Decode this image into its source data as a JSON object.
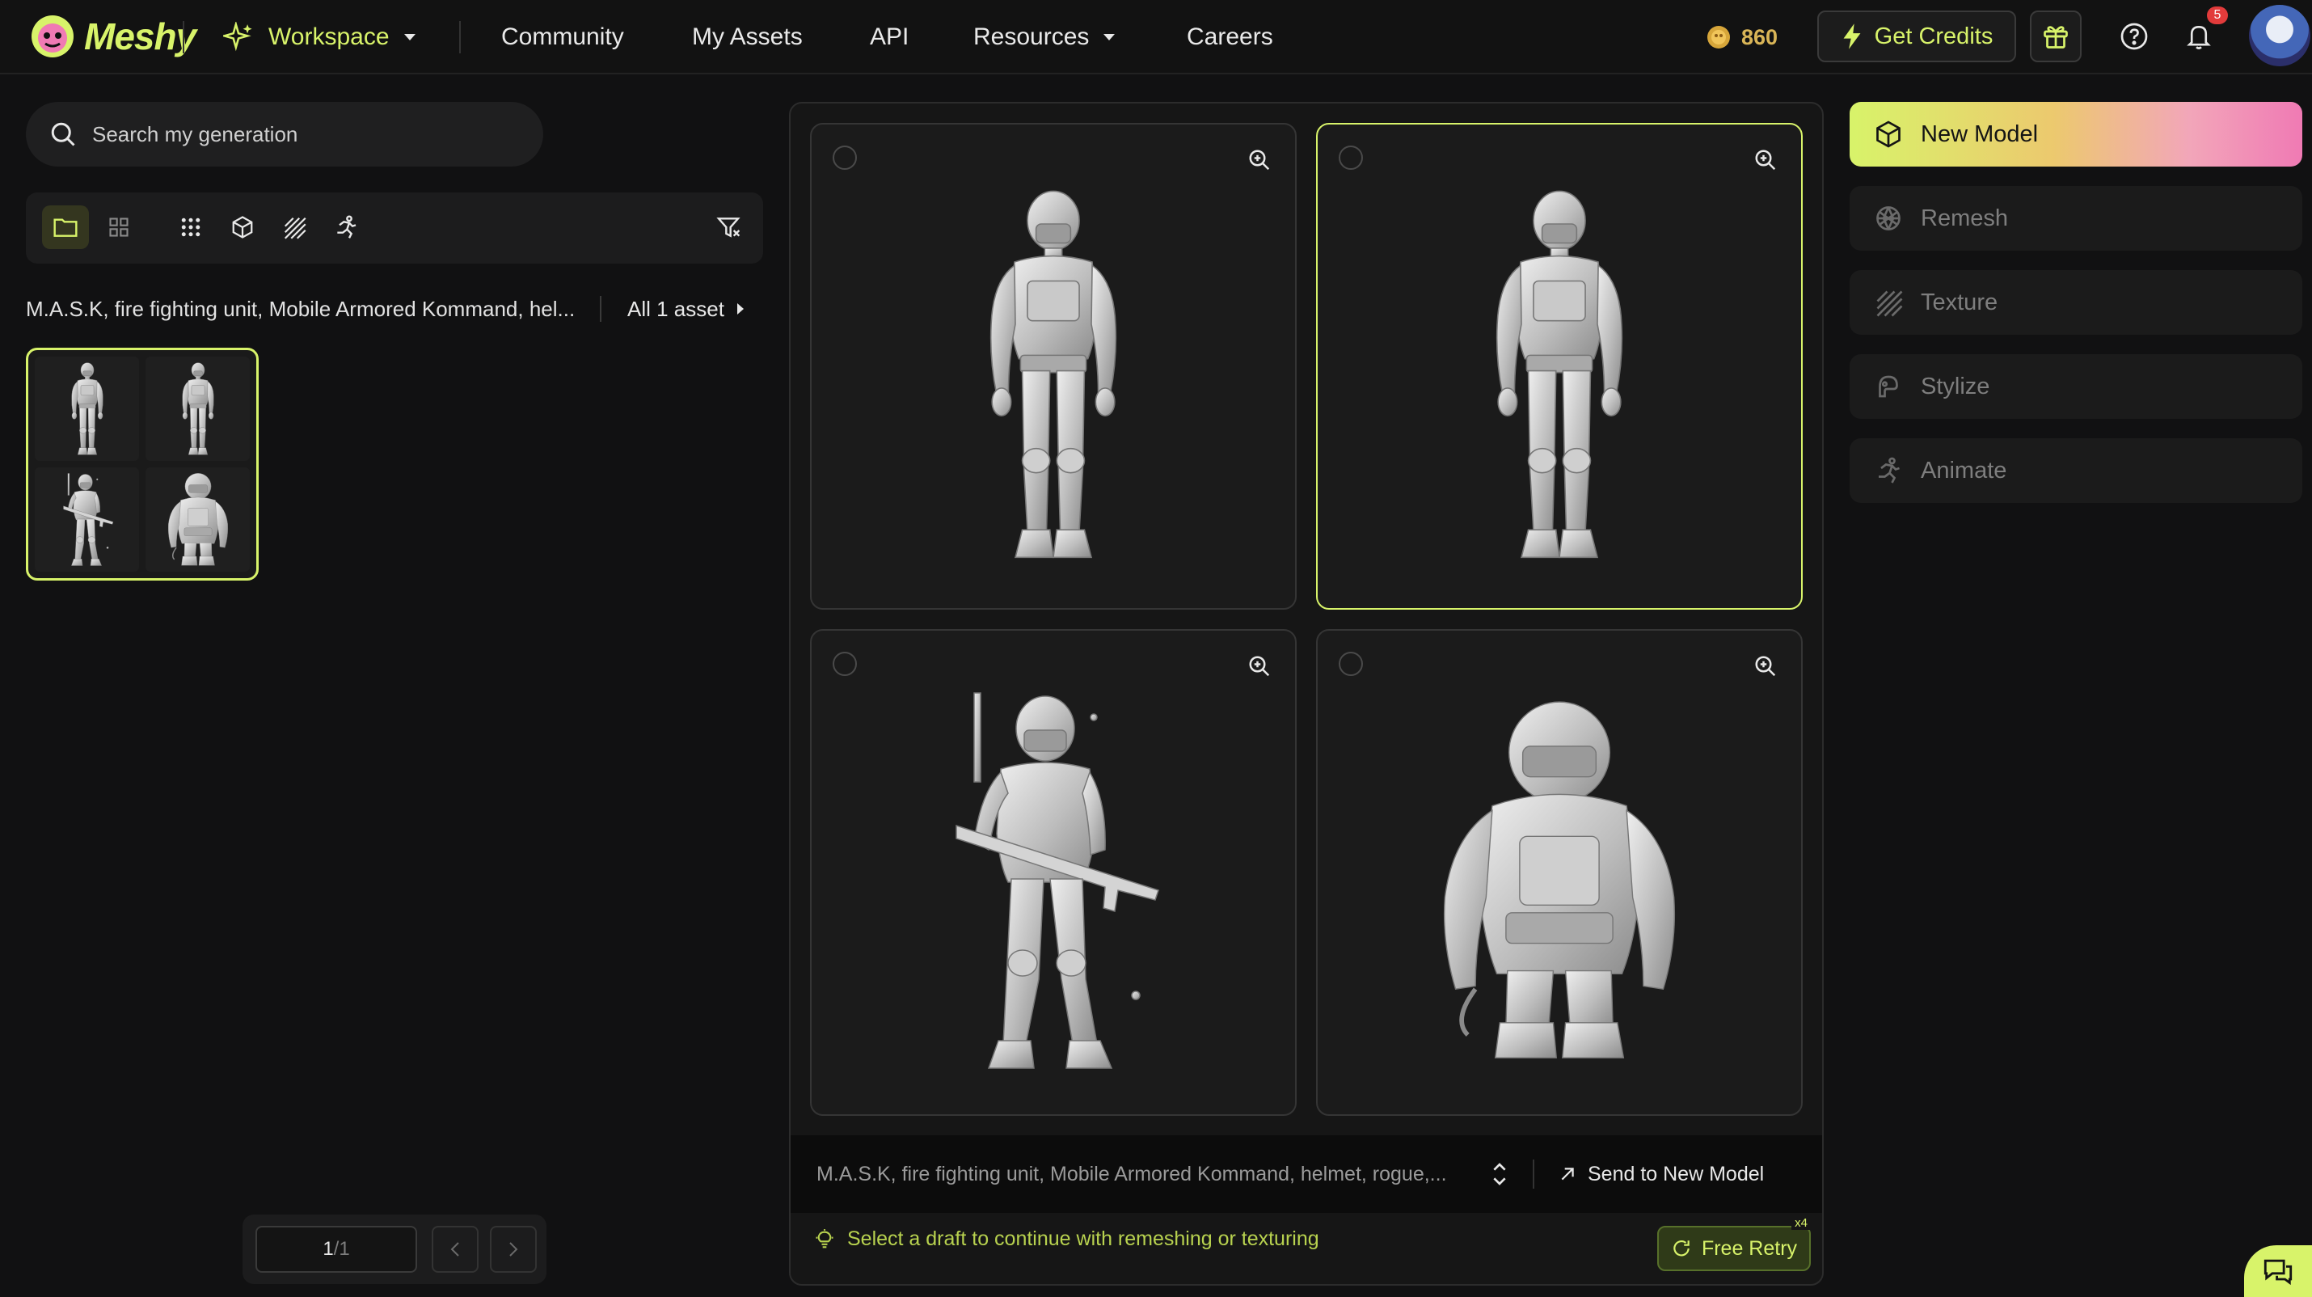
{
  "app": {
    "brand": "Meshy",
    "accent": "#d8f36a"
  },
  "nav": {
    "items": [
      {
        "label": "Workspace",
        "icon": "sparkle-icon",
        "dropdown": true
      },
      {
        "label": "Community"
      },
      {
        "label": "My Assets"
      },
      {
        "label": "API"
      },
      {
        "label": "Resources",
        "dropdown": true
      },
      {
        "label": "Careers"
      }
    ],
    "credits": "860",
    "get_credits_label": "Get Credits",
    "notification_count": "5"
  },
  "sidebar": {
    "search_placeholder": "Search my generation",
    "filters": [
      "folder-view",
      "grid-view",
      "all-types",
      "model",
      "texture",
      "animation"
    ],
    "prompt": "M.A.S.K, fire fighting unit, Mobile Armored Kommand, hel...",
    "all_assets_label": "All 1 asset",
    "pager": {
      "current": "1",
      "total": "/1"
    }
  },
  "center": {
    "drafts": [
      {
        "id": "draft-1",
        "selected": false
      },
      {
        "id": "draft-2",
        "selected": true
      },
      {
        "id": "draft-3",
        "selected": false
      },
      {
        "id": "draft-4",
        "selected": false
      }
    ],
    "prompt": "M.A.S.K, fire fighting unit, Mobile Armored Kommand, helmet, rogue,...",
    "send_label": "Send to New Model",
    "hint": "Select a draft to continue with remeshing or texturing",
    "retry_label": "Free Retry",
    "retry_count": "x4"
  },
  "tools": [
    {
      "label": "New Model",
      "icon": "cube-icon",
      "primary": true
    },
    {
      "label": "Remesh",
      "icon": "remesh-icon"
    },
    {
      "label": "Texture",
      "icon": "texture-icon"
    },
    {
      "label": "Stylize",
      "icon": "stylize-icon"
    },
    {
      "label": "Animate",
      "icon": "animate-icon"
    }
  ]
}
